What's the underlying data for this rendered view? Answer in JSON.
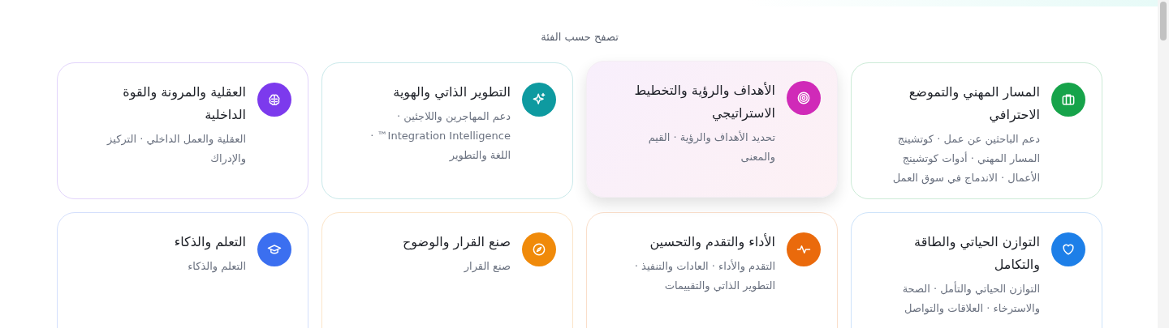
{
  "heading": "تصفح حسب الفئة",
  "categories": [
    {
      "title": "المسار المهني والتموضع الاحترافي",
      "description": "دعم الباحثين عن عمل · كوتشينج المسار المهني · أدوات كوتشينج الأعمال · الاندماج في سوق العمل",
      "color": "#16a34a",
      "hovered": false
    },
    {
      "title": "الأهداف والرؤية والتخطيط الاستراتيجي",
      "description": "تحديد الأهداف والرؤية · القيم والمعنى",
      "color": "#d02ab8",
      "hovered": true
    },
    {
      "title": "التطوير الذاتي والهوية",
      "description": "دعم المهاجرين واللاجئين · Integration Intelligence™ · اللغة والتطوير",
      "color": "#0e9aa0",
      "hovered": false
    },
    {
      "title": "العقلية والمرونة والقوة الداخلية",
      "description": "العقلية والعمل الداخلي · التركيز والإدراك",
      "color": "#7c3aed",
      "hovered": false
    },
    {
      "title": "التوازن الحياتي والطاقة والتكامل",
      "description": "التوازن الحياتي والتأمل · الصحة والاسترخاء · العلاقات والتواصل",
      "color": "#1d7fe8",
      "hovered": false
    },
    {
      "title": "الأداء والتقدم والتحسين",
      "description": "التقدم والأداء · العادات والتنفيذ · التطوير الذاتي والتقييمات",
      "color": "#ea6a0c",
      "hovered": false
    },
    {
      "title": "صنع القرار والوضوح",
      "description": "صنع القرار",
      "color": "#f08a0a",
      "hovered": false
    },
    {
      "title": "التعلم والذكاء",
      "description": "التعلم والذكاء",
      "color": "#3b6ff0",
      "hovered": false
    }
  ]
}
